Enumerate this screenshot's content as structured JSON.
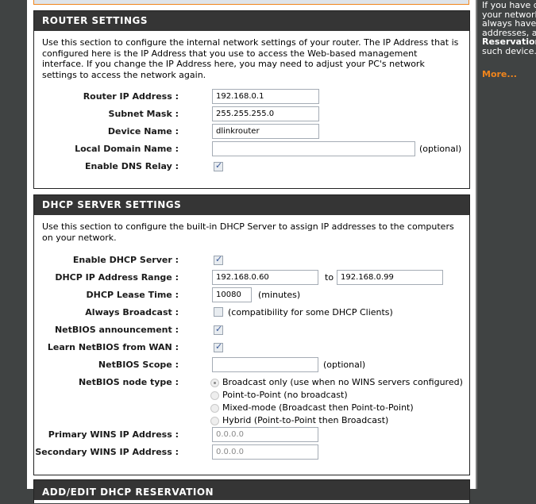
{
  "router_settings": {
    "title": "ROUTER SETTINGS",
    "description": "Use this section to configure the internal network settings of your router. The IP Address that is configured here is the IP Address that you use to access the Web-based management interface. If you change the IP Address here, you may need to adjust your PC's network settings to access the network again.",
    "router_ip_label": "Router IP Address :",
    "router_ip_value": "192.168.0.1",
    "subnet_mask_label": "Subnet Mask :",
    "subnet_mask_value": "255.255.255.0",
    "device_name_label": "Device Name :",
    "device_name_value": "dlinkrouter",
    "local_domain_label": "Local Domain Name :",
    "local_domain_value": "",
    "local_domain_suffix": "(optional)",
    "dns_relay_label": "Enable DNS Relay :",
    "dns_relay_checked": true
  },
  "dhcp_settings": {
    "title": "DHCP SERVER SETTINGS",
    "description": "Use this section to configure the built-in DHCP Server to assign IP addresses to the computers on your network.",
    "enable_label": "Enable DHCP Server :",
    "enable_checked": true,
    "range_label": "DHCP IP Address Range :",
    "range_start": "192.168.0.60",
    "range_to": "to",
    "range_end": "192.168.0.99",
    "lease_label": "DHCP Lease Time :",
    "lease_value": "10080",
    "lease_suffix": "(minutes)",
    "broadcast_label": "Always Broadcast :",
    "broadcast_checked": false,
    "broadcast_suffix": "(compatibility for some DHCP Clients)",
    "netbios_announce_label": "NetBIOS announcement :",
    "netbios_announce_checked": true,
    "learn_netbios_label": "Learn NetBIOS from WAN :",
    "learn_netbios_checked": true,
    "netbios_scope_label": "NetBIOS Scope :",
    "netbios_scope_value": "",
    "netbios_scope_suffix": "(optional)",
    "node_type_label": "NetBIOS node type :",
    "node_type_options": [
      {
        "label": "Broadcast only (use when no WINS servers configured)",
        "selected": true
      },
      {
        "label": "Point-to-Point (no broadcast)",
        "selected": false
      },
      {
        "label": "Mixed-mode (Broadcast then Point-to-Point)",
        "selected": false
      },
      {
        "label": "Hybrid (Point-to-Point then Broadcast)",
        "selected": false
      }
    ],
    "primary_wins_label": "Primary WINS IP Address :",
    "primary_wins_value": "0.0.0.0",
    "secondary_wins_label": "Secondary WINS IP Address :",
    "secondary_wins_value": "0.0.0.0"
  },
  "reservation_section": {
    "title": "ADD/EDIT DHCP RESERVATION"
  },
  "help_sidebar": {
    "lines": [
      "If you have de",
      "your network t",
      "always have fi",
      "addresses, ad"
    ],
    "bold_line": "Reservation",
    "last_line": "such device.",
    "more_link": "More..."
  }
}
